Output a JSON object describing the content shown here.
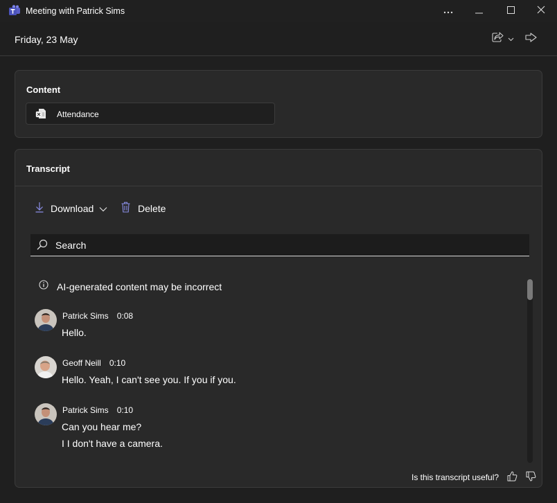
{
  "window": {
    "title": "Meeting with Patrick Sims",
    "icons": [
      "teams-logo-icon",
      "more-options-icon",
      "minimize-icon",
      "maximize-icon",
      "close-icon"
    ]
  },
  "header": {
    "date": "Friday, 23 May",
    "icons": [
      "share-icon",
      "chevron-down-icon",
      "forward-icon"
    ]
  },
  "content": {
    "title": "Content",
    "items": [
      {
        "label": "Attendance",
        "icon": "excel-file-icon"
      }
    ]
  },
  "transcript": {
    "title": "Transcript",
    "download_label": "Download",
    "delete_label": "Delete",
    "search_placeholder": "Search",
    "ai_notice": "AI-generated content may be incorrect",
    "entries": [
      {
        "speaker": "Patrick Sims",
        "time": "0:08",
        "lines": [
          "Hello."
        ]
      },
      {
        "speaker": "Geoff Neill",
        "time": "0:10",
        "lines": [
          "Hello. Yeah, I can't see you. If you if you."
        ]
      },
      {
        "speaker": "Patrick Sims",
        "time": "0:10",
        "lines": [
          "Can you hear me?",
          "I I don't have a camera."
        ]
      }
    ],
    "feedback_question": "Is this transcript useful?"
  },
  "colors": {
    "accent": "#7f85f5",
    "background": "#1f1f1f",
    "card": "#292929"
  }
}
